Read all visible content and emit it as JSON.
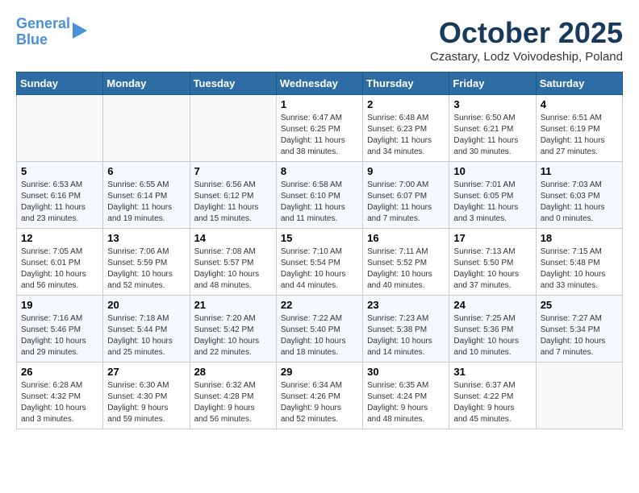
{
  "logo": {
    "line1": "General",
    "line2": "Blue"
  },
  "title": "October 2025",
  "location": "Czastary, Lodz Voivodeship, Poland",
  "weekdays": [
    "Sunday",
    "Monday",
    "Tuesday",
    "Wednesday",
    "Thursday",
    "Friday",
    "Saturday"
  ],
  "weeks": [
    [
      {
        "day": "",
        "info": ""
      },
      {
        "day": "",
        "info": ""
      },
      {
        "day": "",
        "info": ""
      },
      {
        "day": "1",
        "info": "Sunrise: 6:47 AM\nSunset: 6:25 PM\nDaylight: 11 hours\nand 38 minutes."
      },
      {
        "day": "2",
        "info": "Sunrise: 6:48 AM\nSunset: 6:23 PM\nDaylight: 11 hours\nand 34 minutes."
      },
      {
        "day": "3",
        "info": "Sunrise: 6:50 AM\nSunset: 6:21 PM\nDaylight: 11 hours\nand 30 minutes."
      },
      {
        "day": "4",
        "info": "Sunrise: 6:51 AM\nSunset: 6:19 PM\nDaylight: 11 hours\nand 27 minutes."
      }
    ],
    [
      {
        "day": "5",
        "info": "Sunrise: 6:53 AM\nSunset: 6:16 PM\nDaylight: 11 hours\nand 23 minutes."
      },
      {
        "day": "6",
        "info": "Sunrise: 6:55 AM\nSunset: 6:14 PM\nDaylight: 11 hours\nand 19 minutes."
      },
      {
        "day": "7",
        "info": "Sunrise: 6:56 AM\nSunset: 6:12 PM\nDaylight: 11 hours\nand 15 minutes."
      },
      {
        "day": "8",
        "info": "Sunrise: 6:58 AM\nSunset: 6:10 PM\nDaylight: 11 hours\nand 11 minutes."
      },
      {
        "day": "9",
        "info": "Sunrise: 7:00 AM\nSunset: 6:07 PM\nDaylight: 11 hours\nand 7 minutes."
      },
      {
        "day": "10",
        "info": "Sunrise: 7:01 AM\nSunset: 6:05 PM\nDaylight: 11 hours\nand 3 minutes."
      },
      {
        "day": "11",
        "info": "Sunrise: 7:03 AM\nSunset: 6:03 PM\nDaylight: 11 hours\nand 0 minutes."
      }
    ],
    [
      {
        "day": "12",
        "info": "Sunrise: 7:05 AM\nSunset: 6:01 PM\nDaylight: 10 hours\nand 56 minutes."
      },
      {
        "day": "13",
        "info": "Sunrise: 7:06 AM\nSunset: 5:59 PM\nDaylight: 10 hours\nand 52 minutes."
      },
      {
        "day": "14",
        "info": "Sunrise: 7:08 AM\nSunset: 5:57 PM\nDaylight: 10 hours\nand 48 minutes."
      },
      {
        "day": "15",
        "info": "Sunrise: 7:10 AM\nSunset: 5:54 PM\nDaylight: 10 hours\nand 44 minutes."
      },
      {
        "day": "16",
        "info": "Sunrise: 7:11 AM\nSunset: 5:52 PM\nDaylight: 10 hours\nand 40 minutes."
      },
      {
        "day": "17",
        "info": "Sunrise: 7:13 AM\nSunset: 5:50 PM\nDaylight: 10 hours\nand 37 minutes."
      },
      {
        "day": "18",
        "info": "Sunrise: 7:15 AM\nSunset: 5:48 PM\nDaylight: 10 hours\nand 33 minutes."
      }
    ],
    [
      {
        "day": "19",
        "info": "Sunrise: 7:16 AM\nSunset: 5:46 PM\nDaylight: 10 hours\nand 29 minutes."
      },
      {
        "day": "20",
        "info": "Sunrise: 7:18 AM\nSunset: 5:44 PM\nDaylight: 10 hours\nand 25 minutes."
      },
      {
        "day": "21",
        "info": "Sunrise: 7:20 AM\nSunset: 5:42 PM\nDaylight: 10 hours\nand 22 minutes."
      },
      {
        "day": "22",
        "info": "Sunrise: 7:22 AM\nSunset: 5:40 PM\nDaylight: 10 hours\nand 18 minutes."
      },
      {
        "day": "23",
        "info": "Sunrise: 7:23 AM\nSunset: 5:38 PM\nDaylight: 10 hours\nand 14 minutes."
      },
      {
        "day": "24",
        "info": "Sunrise: 7:25 AM\nSunset: 5:36 PM\nDaylight: 10 hours\nand 10 minutes."
      },
      {
        "day": "25",
        "info": "Sunrise: 7:27 AM\nSunset: 5:34 PM\nDaylight: 10 hours\nand 7 minutes."
      }
    ],
    [
      {
        "day": "26",
        "info": "Sunrise: 6:28 AM\nSunset: 4:32 PM\nDaylight: 10 hours\nand 3 minutes."
      },
      {
        "day": "27",
        "info": "Sunrise: 6:30 AM\nSunset: 4:30 PM\nDaylight: 9 hours\nand 59 minutes."
      },
      {
        "day": "28",
        "info": "Sunrise: 6:32 AM\nSunset: 4:28 PM\nDaylight: 9 hours\nand 56 minutes."
      },
      {
        "day": "29",
        "info": "Sunrise: 6:34 AM\nSunset: 4:26 PM\nDaylight: 9 hours\nand 52 minutes."
      },
      {
        "day": "30",
        "info": "Sunrise: 6:35 AM\nSunset: 4:24 PM\nDaylight: 9 hours\nand 48 minutes."
      },
      {
        "day": "31",
        "info": "Sunrise: 6:37 AM\nSunset: 4:22 PM\nDaylight: 9 hours\nand 45 minutes."
      },
      {
        "day": "",
        "info": ""
      }
    ]
  ]
}
